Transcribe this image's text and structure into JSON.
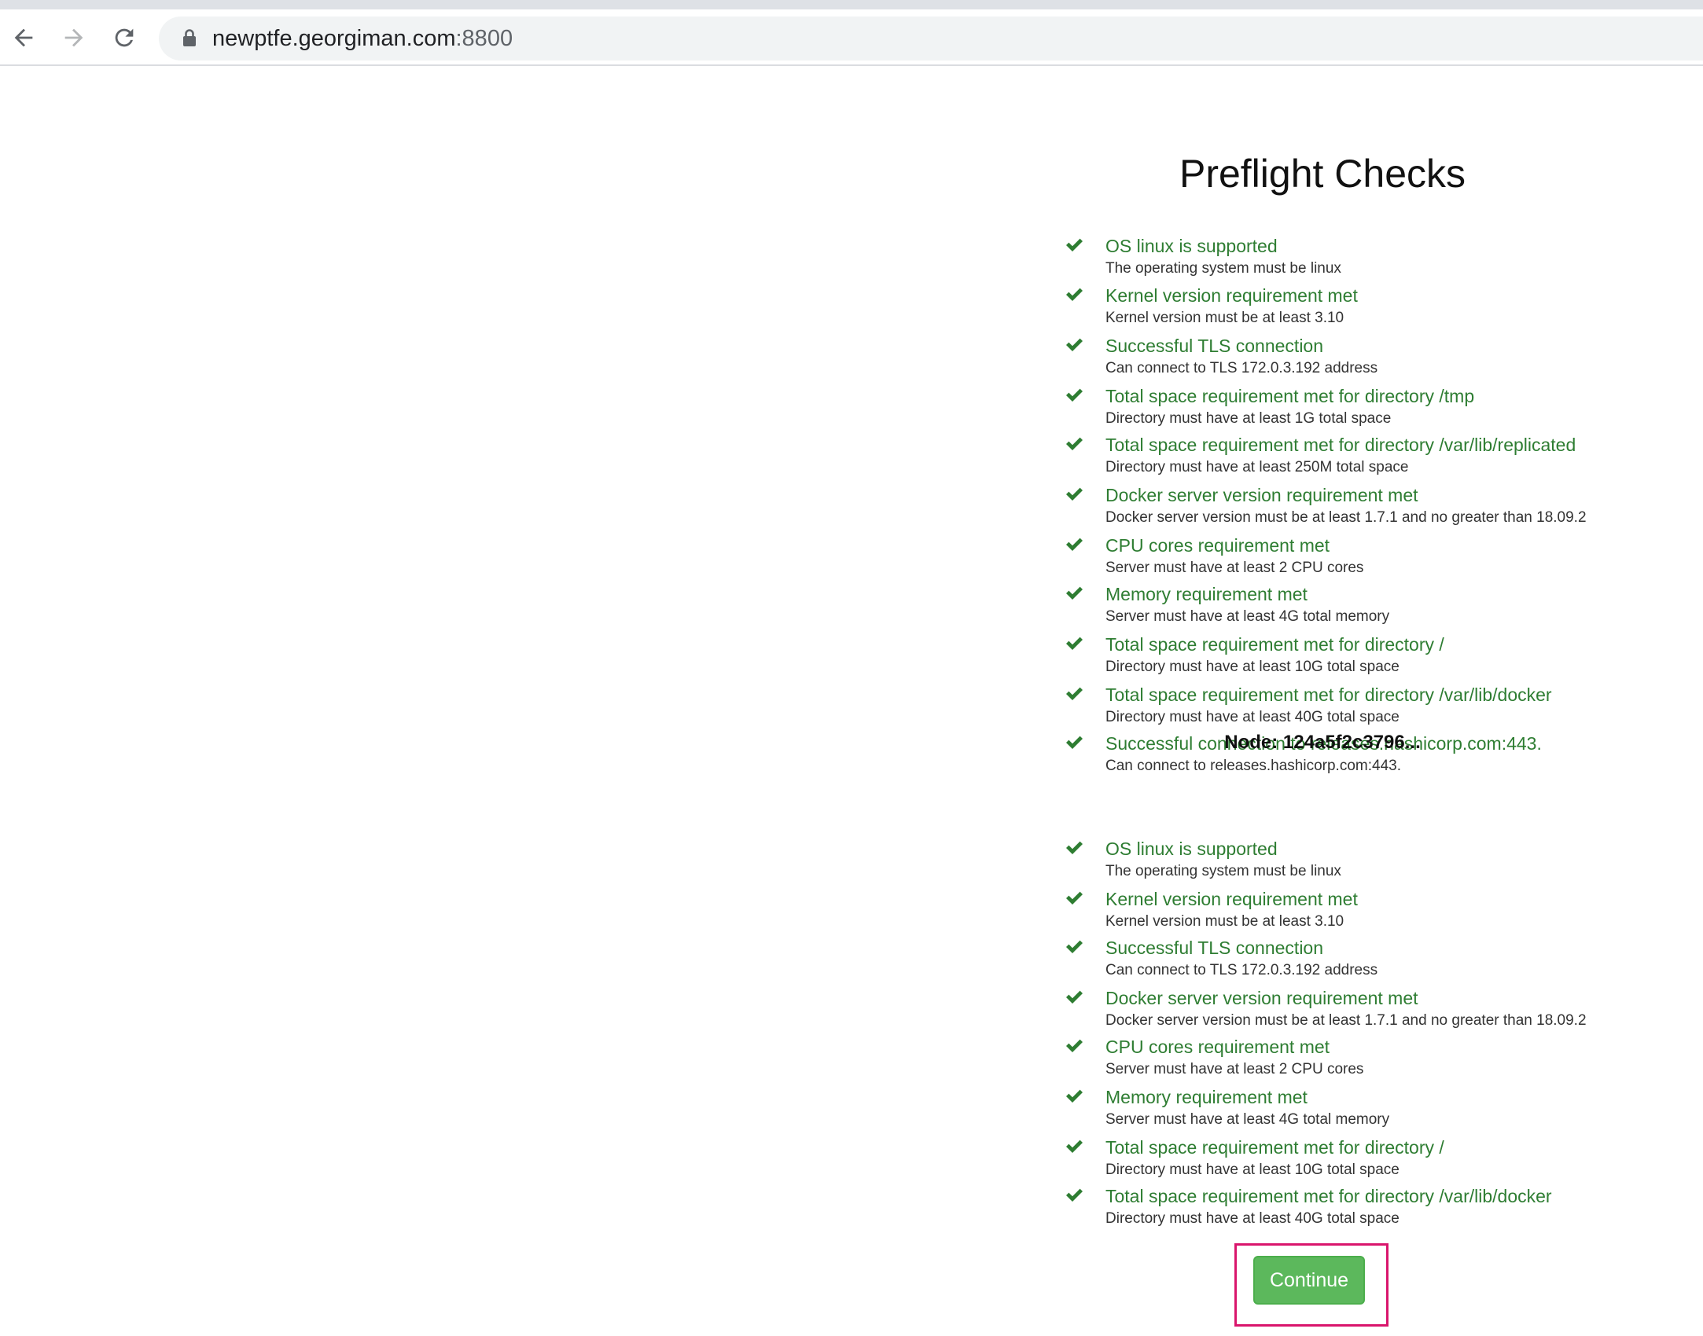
{
  "browser": {
    "url_host": "newptfe.georgiman.com",
    "url_port": ":8800"
  },
  "page": {
    "title": "Preflight Checks",
    "node_heading": "Node: 124a5f2c3796...",
    "continue_label": "Continue",
    "status_color": "#2e7d32",
    "button_color": "#5cb85c"
  },
  "checks": [
    {
      "title": "OS linux is supported",
      "desc": "The operating system must be linux"
    },
    {
      "title": "Kernel version requirement met",
      "desc": "Kernel version must be at least 3.10"
    },
    {
      "title": "Successful TLS connection",
      "desc": "Can connect to TLS 172.0.3.192 address"
    },
    {
      "title": "Total space requirement met for directory /tmp",
      "desc": "Directory must have at least 1G total space"
    },
    {
      "title": "Total space requirement met for directory /var/lib/replicated",
      "desc": "Directory must have at least 250M total space"
    },
    {
      "title": "Docker server version requirement met",
      "desc": "Docker server version must be at least 1.7.1 and no greater than 18.09.2"
    },
    {
      "title": "CPU cores requirement met",
      "desc": "Server must have at least 2 CPU cores"
    },
    {
      "title": "Memory requirement met",
      "desc": "Server must have at least 4G total memory"
    },
    {
      "title": "Total space requirement met for directory /",
      "desc": "Directory must have at least 10G total space"
    },
    {
      "title": "Total space requirement met for directory /var/lib/docker",
      "desc": "Directory must have at least 40G total space"
    },
    {
      "title": "Successful connection to releases.hashicorp.com:443.",
      "desc": "Can connect to releases.hashicorp.com:443."
    }
  ],
  "node_checks": [
    {
      "title": "OS linux is supported",
      "desc": "The operating system must be linux"
    },
    {
      "title": "Kernel version requirement met",
      "desc": "Kernel version must be at least 3.10"
    },
    {
      "title": "Successful TLS connection",
      "desc": "Can connect to TLS 172.0.3.192 address"
    },
    {
      "title": "Docker server version requirement met",
      "desc": "Docker server version must be at least 1.7.1 and no greater than 18.09.2"
    },
    {
      "title": "CPU cores requirement met",
      "desc": "Server must have at least 2 CPU cores"
    },
    {
      "title": "Memory requirement met",
      "desc": "Server must have at least 4G total memory"
    },
    {
      "title": "Total space requirement met for directory /",
      "desc": "Directory must have at least 10G total space"
    },
    {
      "title": "Total space requirement met for directory /var/lib/docker",
      "desc": "Directory must have at least 40G total space"
    }
  ]
}
